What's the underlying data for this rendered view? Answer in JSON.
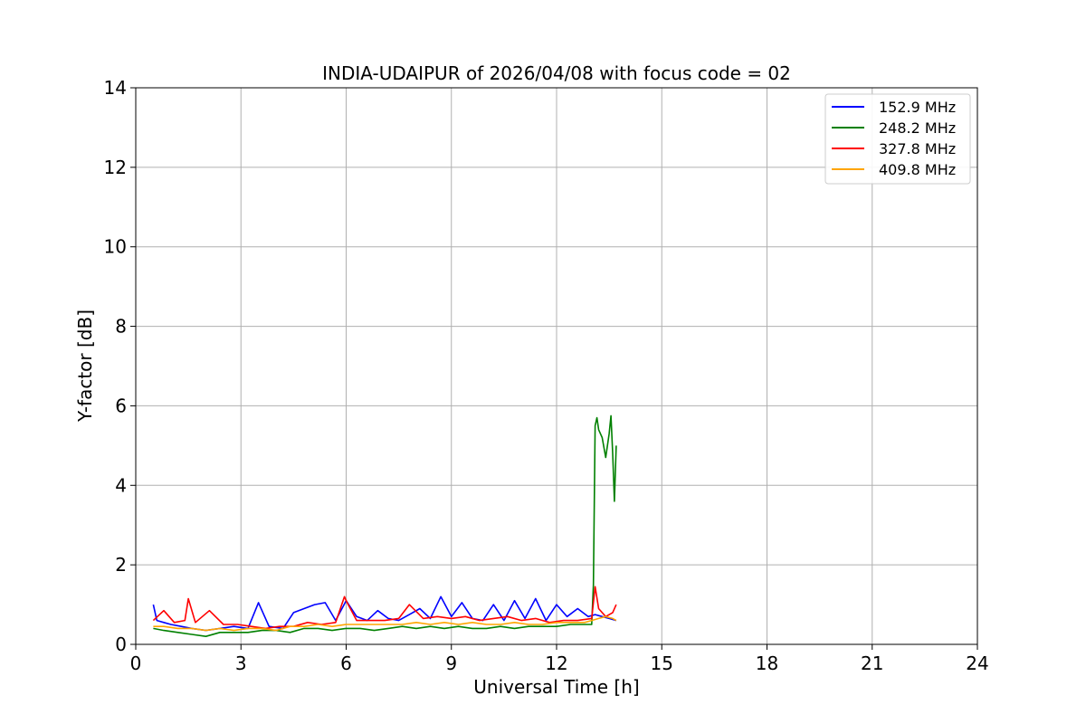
{
  "chart_data": {
    "type": "line",
    "title": "INDIA-UDAIPUR of 2026/04/08 with focus code = 02",
    "xlabel": "Universal Time [h]",
    "ylabel": "Y-factor [dB]",
    "xlim": [
      0,
      24
    ],
    "ylim": [
      0,
      14
    ],
    "xticks": [
      0,
      3,
      6,
      9,
      12,
      15,
      18,
      21,
      24
    ],
    "xtick_labels": [
      "0",
      "3",
      "6",
      "9",
      "12",
      "15",
      "18",
      "21",
      "24"
    ],
    "yticks": [
      0,
      2,
      4,
      6,
      8,
      10,
      12,
      14
    ],
    "ytick_labels": [
      "0",
      "2",
      "4",
      "6",
      "8",
      "10",
      "12",
      "14"
    ],
    "grid": true,
    "legend_position": "top-right",
    "series": [
      {
        "name": "152.9 MHz",
        "color": "#0000ff",
        "x": [
          0.5,
          0.6,
          0.8,
          1.0,
          1.3,
          1.6,
          2.0,
          2.4,
          2.8,
          3.2,
          3.5,
          3.8,
          4.2,
          4.5,
          4.8,
          5.1,
          5.4,
          5.7,
          6.0,
          6.3,
          6.6,
          6.9,
          7.2,
          7.5,
          7.8,
          8.1,
          8.4,
          8.7,
          9.0,
          9.3,
          9.6,
          9.9,
          10.2,
          10.5,
          10.8,
          11.1,
          11.4,
          11.7,
          12.0,
          12.3,
          12.6,
          12.9,
          13.1,
          13.3,
          13.5,
          13.7
        ],
        "y": [
          1.0,
          0.6,
          0.55,
          0.5,
          0.45,
          0.4,
          0.35,
          0.4,
          0.45,
          0.4,
          1.05,
          0.45,
          0.4,
          0.8,
          0.9,
          1.0,
          1.05,
          0.6,
          1.1,
          0.7,
          0.6,
          0.85,
          0.65,
          0.6,
          0.75,
          0.9,
          0.65,
          1.2,
          0.7,
          1.05,
          0.65,
          0.6,
          1.0,
          0.6,
          1.1,
          0.65,
          1.15,
          0.6,
          1.0,
          0.7,
          0.9,
          0.7,
          0.75,
          0.7,
          0.65,
          0.6
        ]
      },
      {
        "name": "248.2 MHz",
        "color": "#008000",
        "x": [
          0.5,
          0.8,
          1.2,
          1.6,
          2.0,
          2.4,
          2.8,
          3.2,
          3.6,
          4.0,
          4.4,
          4.8,
          5.2,
          5.6,
          6.0,
          6.4,
          6.8,
          7.2,
          7.6,
          8.0,
          8.4,
          8.8,
          9.2,
          9.6,
          10.0,
          10.4,
          10.8,
          11.2,
          11.6,
          12.0,
          12.4,
          12.8,
          13.0,
          13.05,
          13.1,
          13.15,
          13.2,
          13.3,
          13.4,
          13.5,
          13.55,
          13.6,
          13.65,
          13.7
        ],
        "y": [
          0.4,
          0.35,
          0.3,
          0.25,
          0.2,
          0.3,
          0.3,
          0.3,
          0.35,
          0.35,
          0.3,
          0.4,
          0.4,
          0.35,
          0.4,
          0.4,
          0.35,
          0.4,
          0.45,
          0.4,
          0.45,
          0.4,
          0.45,
          0.4,
          0.4,
          0.45,
          0.4,
          0.45,
          0.45,
          0.45,
          0.5,
          0.5,
          0.5,
          1.5,
          5.5,
          5.7,
          5.4,
          5.2,
          4.7,
          5.3,
          5.75,
          4.8,
          3.6,
          5.0
        ]
      },
      {
        "name": "327.8 MHz",
        "color": "#ff0000",
        "x": [
          0.5,
          0.8,
          1.1,
          1.4,
          1.5,
          1.7,
          2.1,
          2.5,
          2.9,
          3.3,
          3.7,
          4.1,
          4.5,
          4.9,
          5.3,
          5.7,
          5.95,
          6.0,
          6.3,
          6.7,
          7.1,
          7.5,
          7.8,
          8.2,
          8.6,
          9.0,
          9.4,
          9.8,
          10.2,
          10.6,
          11.0,
          11.4,
          11.8,
          12.2,
          12.6,
          13.0,
          13.1,
          13.2,
          13.4,
          13.6,
          13.7
        ],
        "y": [
          0.6,
          0.85,
          0.55,
          0.6,
          1.15,
          0.55,
          0.85,
          0.5,
          0.5,
          0.45,
          0.4,
          0.45,
          0.45,
          0.55,
          0.5,
          0.55,
          1.2,
          1.1,
          0.6,
          0.6,
          0.6,
          0.65,
          1.0,
          0.65,
          0.7,
          0.65,
          0.7,
          0.6,
          0.65,
          0.7,
          0.6,
          0.65,
          0.55,
          0.6,
          0.6,
          0.65,
          1.45,
          0.9,
          0.7,
          0.8,
          1.0
        ]
      },
      {
        "name": "409.8 MHz",
        "color": "#ffa500",
        "x": [
          0.5,
          0.8,
          1.2,
          1.6,
          2.0,
          2.4,
          2.8,
          3.2,
          3.6,
          4.0,
          4.4,
          4.8,
          5.2,
          5.6,
          6.0,
          6.4,
          6.8,
          7.2,
          7.6,
          8.0,
          8.4,
          8.8,
          9.2,
          9.6,
          10.0,
          10.4,
          10.8,
          11.2,
          11.6,
          12.0,
          12.4,
          12.8,
          13.0,
          13.2,
          13.4,
          13.6,
          13.7
        ],
        "y": [
          0.45,
          0.45,
          0.4,
          0.4,
          0.35,
          0.4,
          0.35,
          0.4,
          0.4,
          0.35,
          0.45,
          0.45,
          0.5,
          0.45,
          0.5,
          0.5,
          0.5,
          0.5,
          0.5,
          0.55,
          0.5,
          0.55,
          0.5,
          0.55,
          0.5,
          0.5,
          0.55,
          0.5,
          0.5,
          0.55,
          0.55,
          0.55,
          0.6,
          0.65,
          0.7,
          0.65,
          0.6
        ]
      }
    ]
  }
}
